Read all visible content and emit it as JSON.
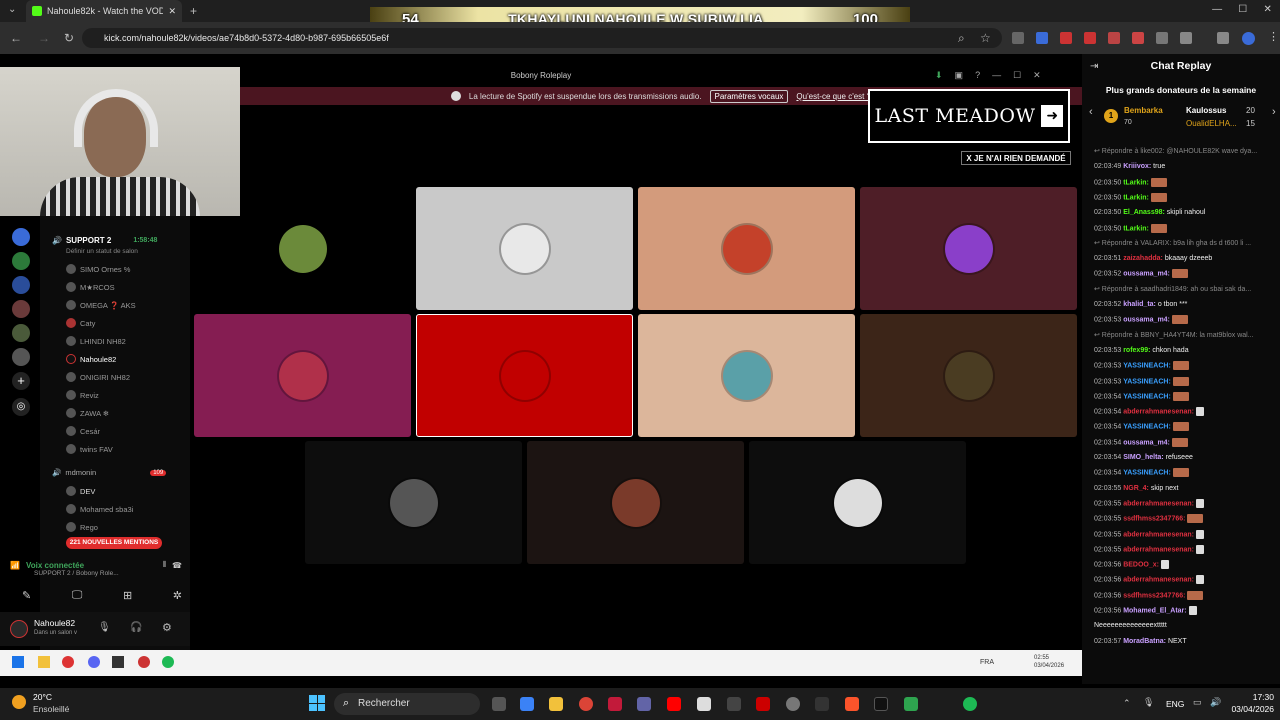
{
  "browser": {
    "tab_title": "Nahoule82k - Watch the VOD",
    "url": "kick.com/nahoule82k/videos/ae74b8d0-5372-4d80-b987-695b66505e6f"
  },
  "banner": {
    "left": "54",
    "text": "TKHAYLUNI NAHOULE W SUBIW LIA",
    "right": "100"
  },
  "discord": {
    "window_title": "Bobony Roleplay",
    "spotify_notice": "La lecture de Spotify est suspendue lors des transmissions audio.",
    "spotify_button": "Paramètres vocaux",
    "spotify_link": "Qu'est-ce que c'est ?",
    "channels": [
      {
        "label": "SUPPORT 2",
        "time": "1:58:48"
      },
      {
        "label": "Définir un statut de salon"
      },
      {
        "label": "SIMO Ornes %"
      },
      {
        "label": "M★RCOS"
      },
      {
        "label": "OMEGA ❓ AKS"
      },
      {
        "label": "Caty"
      },
      {
        "label": "LHINDI  NH82"
      },
      {
        "label": "Nahoule82"
      },
      {
        "label": "ONIGIRI  NH82"
      },
      {
        "label": "Reviz"
      },
      {
        "label": "ZAWA ❄"
      },
      {
        "label": "Cesár"
      },
      {
        "label": "twins  FAV"
      },
      {
        "label": "mdmonin",
        "badge": "109"
      },
      {
        "label": "DEV"
      },
      {
        "label": "Mohamed sba3i"
      },
      {
        "label": "Rego"
      }
    ],
    "mentions": "221 NOUVELLES MENTIONS",
    "voice_status": "Voix connectée",
    "voice_channel": "SUPPORT 2 / Bobony Role...",
    "username": "Nahoule82",
    "user_status": "Dans un salon v"
  },
  "overlay": {
    "last_meadow": "LAST MEADOW",
    "nothing": "X JE N'AI RIEN DEMANDÉ"
  },
  "tiles": [
    {
      "bg": "#000000",
      "avatar": "#6b8a3a"
    },
    {
      "bg": "#c9c9c9",
      "avatar": "#e8e8e8"
    },
    {
      "bg": "#d39b7c",
      "avatar": "#c4412a"
    },
    {
      "bg": "#4e1e27",
      "avatar": "#8a3fc9"
    },
    {
      "bg": "#851d52",
      "avatar": "#b0304a"
    },
    {
      "bg": "#c10000",
      "avatar": "#c10000"
    },
    {
      "bg": "#dcb69b",
      "avatar": "#5aa0a8"
    },
    {
      "bg": "#3c2518",
      "avatar": "#4a3c22"
    },
    {
      "bg": "#0d0d0d",
      "avatar": "#555555"
    },
    {
      "bg": "#1c1412",
      "avatar": "#7a3a2a"
    },
    {
      "bg": "#0d0d0d",
      "avatar": "#dddddd"
    }
  ],
  "inner_taskbar": {
    "time": "02:55",
    "date": "03/04/2026",
    "lang": "FRA"
  },
  "chat": {
    "title": "Chat Replay",
    "donors_title": "Plus grands donateurs de la semaine",
    "donors": [
      {
        "rank": "1",
        "name": "Bembarka",
        "amount": "70"
      },
      {
        "name": "Kaulossus",
        "amount": "20"
      },
      {
        "name": "OualidELHA...",
        "amount": "15"
      }
    ],
    "messages": [
      {
        "time": "",
        "user": "Répondre à like002: @NAHOULE82K wave dya...",
        "color": "#888",
        "text": ""
      },
      {
        "time": "02:03:49",
        "user": "Kriiivox:",
        "color": "#c9a0ff",
        "text": "true"
      },
      {
        "time": "02:03:50",
        "user": "tLarkin:",
        "color": "#53fc18",
        "text": ""
      },
      {
        "time": "02:03:50",
        "user": "tLarkin:",
        "color": "#53fc18",
        "text": ""
      },
      {
        "time": "02:03:50",
        "user": "El_Anass98:",
        "color": "#53fc18",
        "text": "skipli nahoul"
      },
      {
        "time": "02:03:50",
        "user": "tLarkin:",
        "color": "#53fc18",
        "text": ""
      },
      {
        "time": "",
        "user": "Répondre à VALARIX: b9a lih gha ds d t600 li ...",
        "color": "#888",
        "text": ""
      },
      {
        "time": "02:03:51",
        "user": "zaizahadda:",
        "color": "#e03040",
        "text": "bkaaay dzeeeb"
      },
      {
        "time": "02:03:52",
        "user": "oussama_m4:",
        "color": "#c9a0ff",
        "text": ""
      },
      {
        "time": "",
        "user": "Répondre à saadhadri1849: ah ou sbai sak da...",
        "color": "#888",
        "text": ""
      },
      {
        "time": "02:03:52",
        "user": "khalid_ta:",
        "color": "#c9a0ff",
        "text": "o tbon ***"
      },
      {
        "time": "02:03:53",
        "user": "oussama_m4:",
        "color": "#c9a0ff",
        "text": ""
      },
      {
        "time": "",
        "user": "Répondre à BBNY_HA4YT4M: la mat9blox wal...",
        "color": "#888",
        "text": ""
      },
      {
        "time": "02:03:53",
        "user": "rofex99:",
        "color": "#53fc18",
        "text": "chkon hada"
      },
      {
        "time": "02:03:53",
        "user": "YASSINEACH:",
        "color": "#3aa0ff",
        "text": ""
      },
      {
        "time": "02:03:53",
        "user": "YASSINEACH:",
        "color": "#3aa0ff",
        "text": ""
      },
      {
        "time": "02:03:54",
        "user": "YASSINEACH:",
        "color": "#3aa0ff",
        "text": ""
      },
      {
        "time": "02:03:54",
        "user": "abderrahmanesenan:",
        "color": "#e03040",
        "text": ""
      },
      {
        "time": "02:03:54",
        "user": "YASSINEACH:",
        "color": "#3aa0ff",
        "text": ""
      },
      {
        "time": "02:03:54",
        "user": "oussama_m4:",
        "color": "#c9a0ff",
        "text": ""
      },
      {
        "time": "02:03:54",
        "user": "SIMO_helta:",
        "color": "#c9a0ff",
        "text": "refuseee"
      },
      {
        "time": "02:03:54",
        "user": "YASSINEACH:",
        "color": "#3aa0ff",
        "text": ""
      },
      {
        "time": "02:03:55",
        "user": "NGR_4:",
        "color": "#e03040",
        "text": "skip next"
      },
      {
        "time": "02:03:55",
        "user": "abderrahmanesenan:",
        "color": "#e03040",
        "text": ""
      },
      {
        "time": "02:03:55",
        "user": "ssdfhmss2347766:",
        "color": "#e03040",
        "text": ""
      },
      {
        "time": "02:03:55",
        "user": "abderrahmanesenan:",
        "color": "#e03040",
        "text": ""
      },
      {
        "time": "02:03:55",
        "user": "abderrahmanesenan:",
        "color": "#e03040",
        "text": ""
      },
      {
        "time": "02:03:56",
        "user": "BEDOO_x:",
        "color": "#e03040",
        "text": ""
      },
      {
        "time": "02:03:56",
        "user": "abderrahmanesenan:",
        "color": "#e03040",
        "text": ""
      },
      {
        "time": "02:03:56",
        "user": "ssdfhmss2347766:",
        "color": "#e03040",
        "text": ""
      },
      {
        "time": "02:03:56",
        "user": "Mohamed_El_Atar:",
        "color": "#c9a0ff",
        "text": ""
      },
      {
        "time": "",
        "user": "",
        "color": "#eee",
        "text": "Neeeeeeeeeeeeeexttttt"
      },
      {
        "time": "02:03:57",
        "user": "MoradBatna:",
        "color": "#c9a0ff",
        "text": "NEXT"
      }
    ]
  },
  "taskbar": {
    "weather_temp": "20°C",
    "weather_text": "Ensoleillé",
    "search": "Rechercher",
    "lang": "ENG",
    "time": "17:30",
    "date": "03/04/2026"
  },
  "colors": {
    "accent": "#53fc18",
    "discord_red": "#e02d2d",
    "spotify_bar": "#4b1520"
  }
}
